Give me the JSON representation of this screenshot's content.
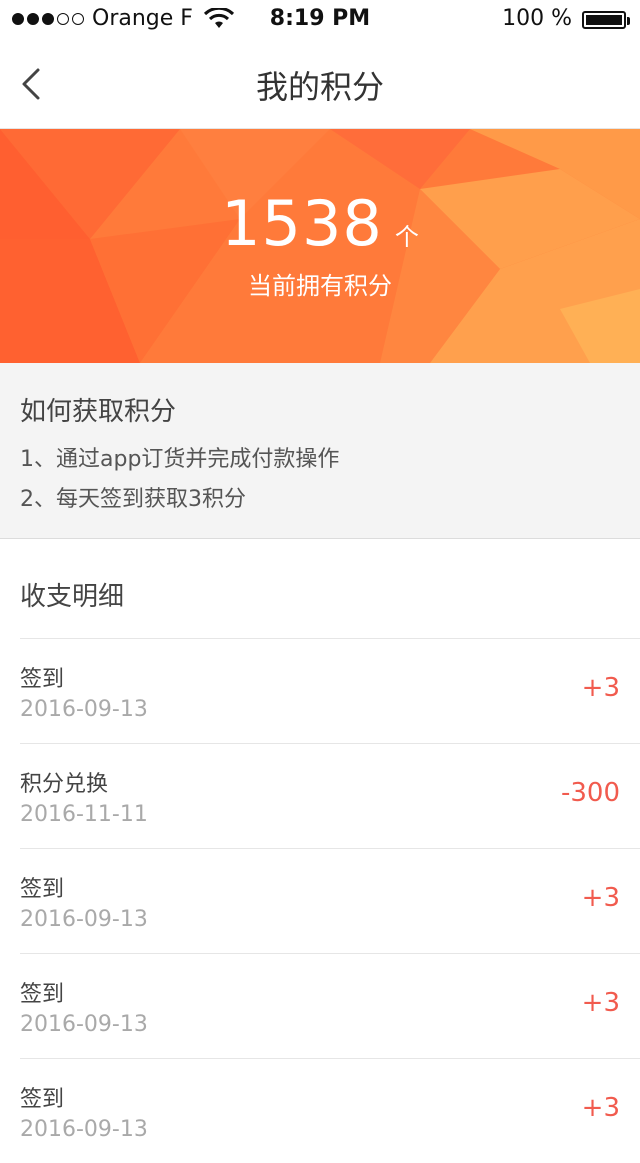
{
  "status_bar": {
    "carrier": "Orange F",
    "time": "8:19 PM",
    "battery": "100 %"
  },
  "nav": {
    "title": "我的积分"
  },
  "points": {
    "value": "1538",
    "unit": "个",
    "label": "当前拥有积分"
  },
  "how_to": {
    "title": "如何获取积分",
    "items": [
      "1、通过app订货并完成付款操作",
      "2、每天签到获取3积分"
    ]
  },
  "history": {
    "title": "收支明细",
    "rows": [
      {
        "title": "签到",
        "date": "2016-09-13",
        "amount": "+3"
      },
      {
        "title": "积分兑换",
        "date": "2016-11-11",
        "amount": "-300"
      },
      {
        "title": "签到",
        "date": "2016-09-13",
        "amount": "+3"
      },
      {
        "title": "签到",
        "date": "2016-09-13",
        "amount": "+3"
      },
      {
        "title": "签到",
        "date": "2016-09-13",
        "amount": "+3"
      }
    ]
  },
  "colors": {
    "accent": "#f15b4e",
    "hero_orange": "#ff8a3d"
  },
  "icons": [
    "chevron-left-icon",
    "wifi-icon",
    "battery-icon",
    "signal-icon"
  ]
}
